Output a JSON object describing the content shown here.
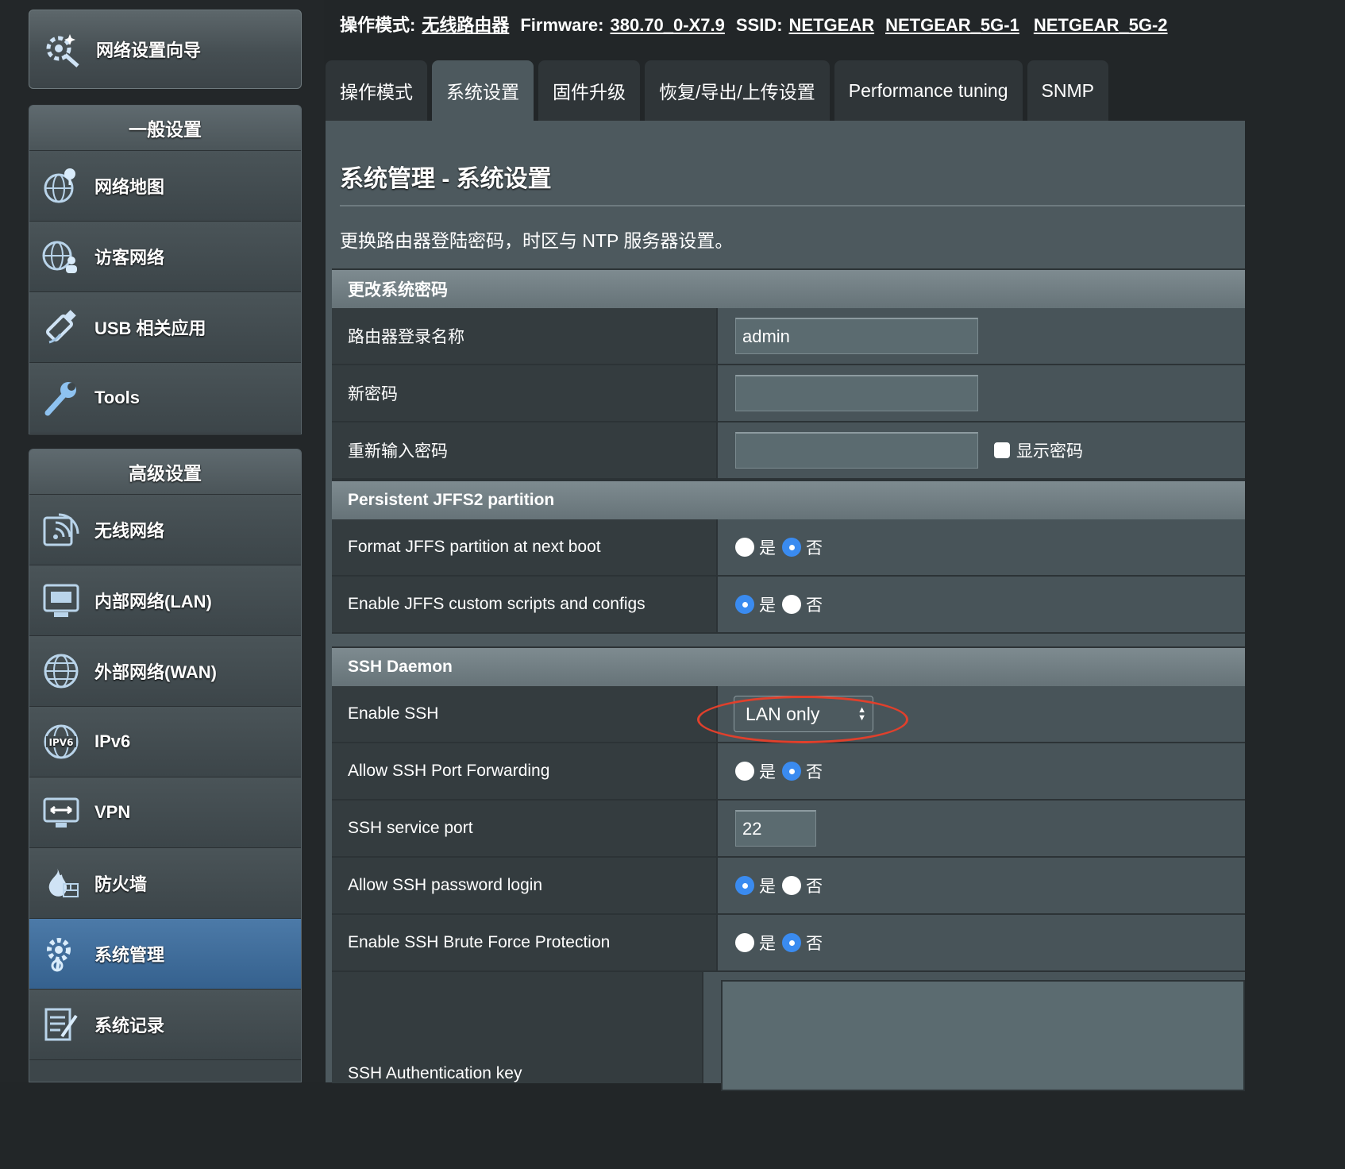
{
  "header": {
    "mode_label": "操作模式:",
    "mode_value": "无线路由器",
    "firmware_label": "Firmware:",
    "firmware_value": "380.70_0-X7.9",
    "ssid_label": "SSID:",
    "ssids": [
      "NETGEAR",
      "NETGEAR_5G-1",
      "NETGEAR_5G-2"
    ]
  },
  "tabs": [
    "操作模式",
    "系统设置",
    "固件升级",
    "恢复/导出/上传设置",
    "Performance tuning",
    "SNMP"
  ],
  "active_tab": "系统设置",
  "sidebar": {
    "wizard": "网络设置向导",
    "general_title": "一般设置",
    "general_items": [
      {
        "label": "网络地图",
        "icon": "network-map-icon"
      },
      {
        "label": "访客网络",
        "icon": "guest-network-icon"
      },
      {
        "label": "USB 相关应用",
        "icon": "usb-icon"
      },
      {
        "label": "Tools",
        "icon": "wrench-icon"
      }
    ],
    "advanced_title": "高级设置",
    "advanced_items": [
      {
        "label": "无线网络",
        "icon": "wireless-icon"
      },
      {
        "label": "内部网络(LAN)",
        "icon": "lan-icon"
      },
      {
        "label": "外部网络(WAN)",
        "icon": "globe-icon"
      },
      {
        "label": "IPv6",
        "icon": "ipv6-icon"
      },
      {
        "label": "VPN",
        "icon": "vpn-icon"
      },
      {
        "label": "防火墙",
        "icon": "firewall-icon"
      },
      {
        "label": "系统管理",
        "icon": "admin-gear-icon"
      },
      {
        "label": "系统记录",
        "icon": "system-log-icon"
      }
    ],
    "active_item": "系统管理"
  },
  "page": {
    "title": "系统管理 - 系统设置",
    "description": "更换路由器登陆密码，时区与 NTP 服务器设置。"
  },
  "sections": {
    "password": {
      "title": "更改系统密码",
      "login_name_label": "路由器登录名称",
      "login_name_value": "admin",
      "new_password_label": "新密码",
      "new_password_value": "",
      "retype_label": "重新输入密码",
      "retype_value": "",
      "show_password_label": "显示密码"
    },
    "jffs": {
      "title": "Persistent JFFS2 partition",
      "format_label": "Format JFFS partition at next boot",
      "format_value": "否",
      "scripts_label": "Enable JFFS custom scripts and configs",
      "scripts_value": "是"
    },
    "ssh": {
      "title": "SSH Daemon",
      "enable_label": "Enable SSH",
      "enable_value": "LAN only",
      "port_forward_label": "Allow SSH Port Forwarding",
      "port_forward_value": "否",
      "port_label": "SSH service port",
      "port_value": "22",
      "password_login_label": "Allow SSH password login",
      "password_login_value": "是",
      "brute_force_label": "Enable SSH Brute Force Protection",
      "brute_force_value": "否",
      "auth_key_label": "SSH Authentication key"
    }
  },
  "radio_yes": "是",
  "radio_no": "否",
  "colors": {
    "active_blue": "#3a8bf0",
    "highlight_red": "#e0402c",
    "active_nav": "#35618e"
  }
}
